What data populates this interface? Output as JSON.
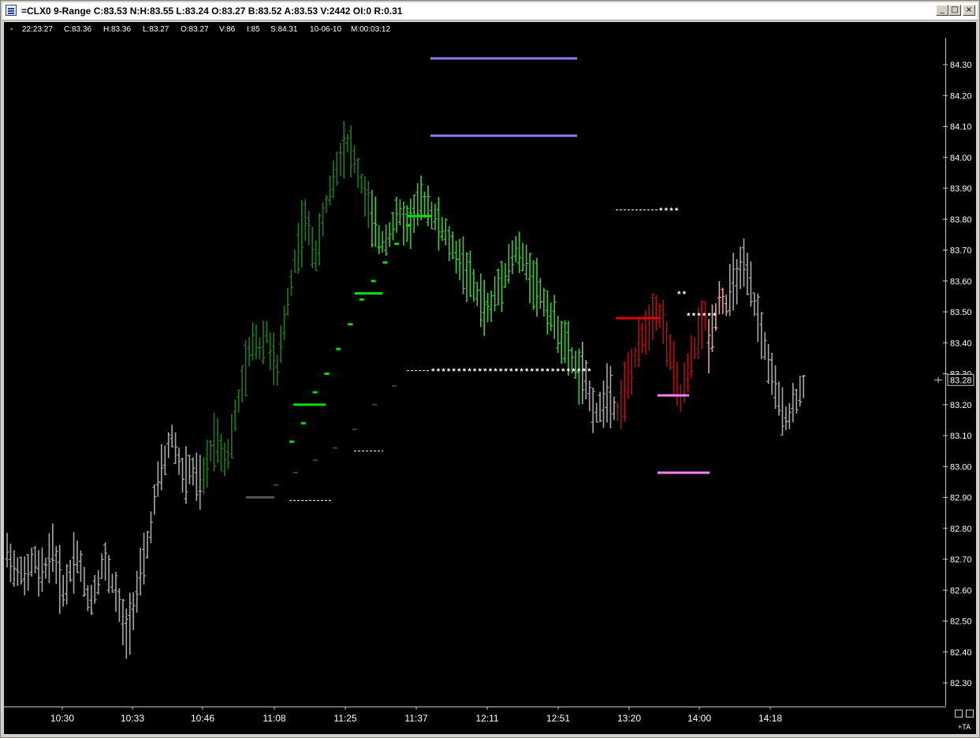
{
  "window": {
    "title": "=CLX0 9-Range C:83.53 N:H:83.55 L:83.24 O:83.27 B:83.52 A:83.53 V:2442 OI:0 R:0.31",
    "controls": {
      "minimize": "_",
      "maximize": "□",
      "close": "×"
    }
  },
  "status": {
    "time": "22:23:27",
    "close": "C:83.36",
    "high": "H:83.36",
    "low": "L:83.27",
    "open": "O:83.27",
    "volume": "V:86",
    "i": "I:85",
    "s": "S:84.31",
    "date": "10-06-10",
    "m": "M:00:03:12"
  },
  "footer": {
    "ta_label": "+TA"
  },
  "chart_data": {
    "type": "bar",
    "subtype": "ohlc-range-bars",
    "y_axis": {
      "min": 82.25,
      "max": 84.35,
      "ticks": [
        84.3,
        84.2,
        84.1,
        84.0,
        83.9,
        83.8,
        83.7,
        83.6,
        83.5,
        83.4,
        83.3,
        83.2,
        83.1,
        83.0,
        82.9,
        82.8,
        82.7,
        82.6,
        82.5,
        82.4,
        82.3
      ],
      "tick_labels": [
        "84.30",
        "84.20",
        "84.10",
        "84.00",
        "83.90",
        "83.80",
        "83.70",
        "83.60",
        "83.50",
        "83.40",
        "83.30",
        "83.20",
        "83.10",
        "83.00",
        "82.90",
        "82.80",
        "82.70",
        "82.60",
        "82.50",
        "82.40",
        "82.30"
      ],
      "last_price_label": "83.28",
      "last_price": 83.28
    },
    "x_axis": {
      "labels": [
        "10:30",
        "10:33",
        "10:46",
        "11:08",
        "11:25",
        "11:37",
        "12:11",
        "12:51",
        "13:20",
        "14:00",
        "14:18"
      ]
    },
    "segments": [
      {
        "color": "#a8a8a8",
        "bars": 56,
        "path": [
          82.72,
          82.7,
          82.64,
          82.68,
          82.62,
          82.68,
          82.7,
          82.64,
          82.66,
          82.7,
          82.74,
          82.66,
          82.6,
          82.62,
          82.68,
          82.72,
          82.68,
          82.6,
          82.56,
          82.6,
          82.64,
          82.7,
          82.66,
          82.62,
          82.58,
          82.5,
          82.46,
          82.52,
          82.58,
          82.64,
          82.7,
          82.78,
          82.88,
          82.96,
          83.0,
          83.06,
          83.1,
          83.04,
          82.98,
          82.96,
          83.0,
          82.96,
          82.94
        ]
      },
      {
        "color": "#1e7a1e",
        "bars": 48,
        "path": [
          82.96,
          83.04,
          83.1,
          83.06,
          83.02,
          83.1,
          83.2,
          83.28,
          83.36,
          83.42,
          83.38,
          83.44,
          83.36,
          83.3,
          83.44,
          83.56,
          83.66,
          83.74,
          83.8,
          83.72,
          83.68,
          83.8,
          83.88,
          83.94,
          84.0,
          84.06,
          84.02,
          83.96,
          83.9,
          83.84
        ]
      },
      {
        "color": "#3ec83e",
        "bars": 60,
        "path": [
          83.8,
          83.72,
          83.76,
          83.82,
          83.78,
          83.84,
          83.86,
          83.8,
          83.76,
          83.7,
          83.66,
          83.6,
          83.54,
          83.5,
          83.58,
          83.64,
          83.7,
          83.66,
          83.6,
          83.54,
          83.48,
          83.42,
          83.36,
          83.3
        ]
      },
      {
        "color": "#a8a8a8",
        "bars": 10,
        "path": [
          83.3,
          83.24,
          83.2,
          83.16,
          83.22,
          83.26,
          83.2
        ]
      },
      {
        "color": "#b01010",
        "bars": 26,
        "path": [
          83.18,
          83.24,
          83.3,
          83.36,
          83.42,
          83.46,
          83.52,
          83.48,
          83.4,
          83.3,
          83.22,
          83.28,
          83.36,
          83.44,
          83.48
        ]
      },
      {
        "color": "#e0a0a0",
        "bars": 6,
        "path": [
          83.4,
          83.48,
          83.56,
          83.52
        ]
      },
      {
        "color": "#a8a8a8",
        "bars": 22,
        "path": [
          83.56,
          83.62,
          83.64,
          83.56,
          83.46,
          83.36,
          83.26,
          83.18,
          83.16,
          83.22,
          83.26
        ]
      }
    ],
    "lines": [
      {
        "color": "#8a7cf0",
        "y": 84.32,
        "from": 541,
        "to": 727
      },
      {
        "color": "#8a7cf0",
        "y": 84.07,
        "from": 541,
        "to": 727
      },
      {
        "color": "#e00000",
        "y": 83.48,
        "from": 776,
        "to": 833
      },
      {
        "color": "#ff80ff",
        "y": 83.23,
        "from": 829,
        "to": 869
      },
      {
        "color": "#ff80ff",
        "y": 82.98,
        "from": 829,
        "to": 895
      },
      {
        "color": "#00e000",
        "y": 83.81,
        "from": 511,
        "to": 543
      },
      {
        "color": "#00e000",
        "y": 83.56,
        "from": 445,
        "to": 480
      },
      {
        "color": "#00e000",
        "y": 83.2,
        "from": 367,
        "to": 408
      },
      {
        "color": "#505050",
        "y": 82.9,
        "from": 307,
        "to": 343
      }
    ],
    "dotted_lines": [
      {
        "y": 83.83,
        "from": 776,
        "to": 830,
        "stars": "****"
      },
      {
        "y": 83.31,
        "from": 511,
        "to": 541,
        "stars": "*******************************"
      },
      {
        "y": 83.05,
        "from": 444,
        "to": 481,
        "stars": ""
      },
      {
        "y": 82.89,
        "from": 362,
        "to": 415,
        "stars": ""
      }
    ],
    "star_labels": [
      {
        "text": "**",
        "y": 83.56
      },
      {
        "text": "******",
        "y": 83.49
      }
    ],
    "green_dots": [
      83.08,
      83.14,
      83.24,
      83.3,
      83.38,
      83.46,
      83.54,
      83.6,
      83.66,
      83.72,
      83.78
    ],
    "black_dots": [
      82.94,
      82.98,
      83.02,
      83.06,
      83.12,
      83.2,
      83.26
    ]
  }
}
